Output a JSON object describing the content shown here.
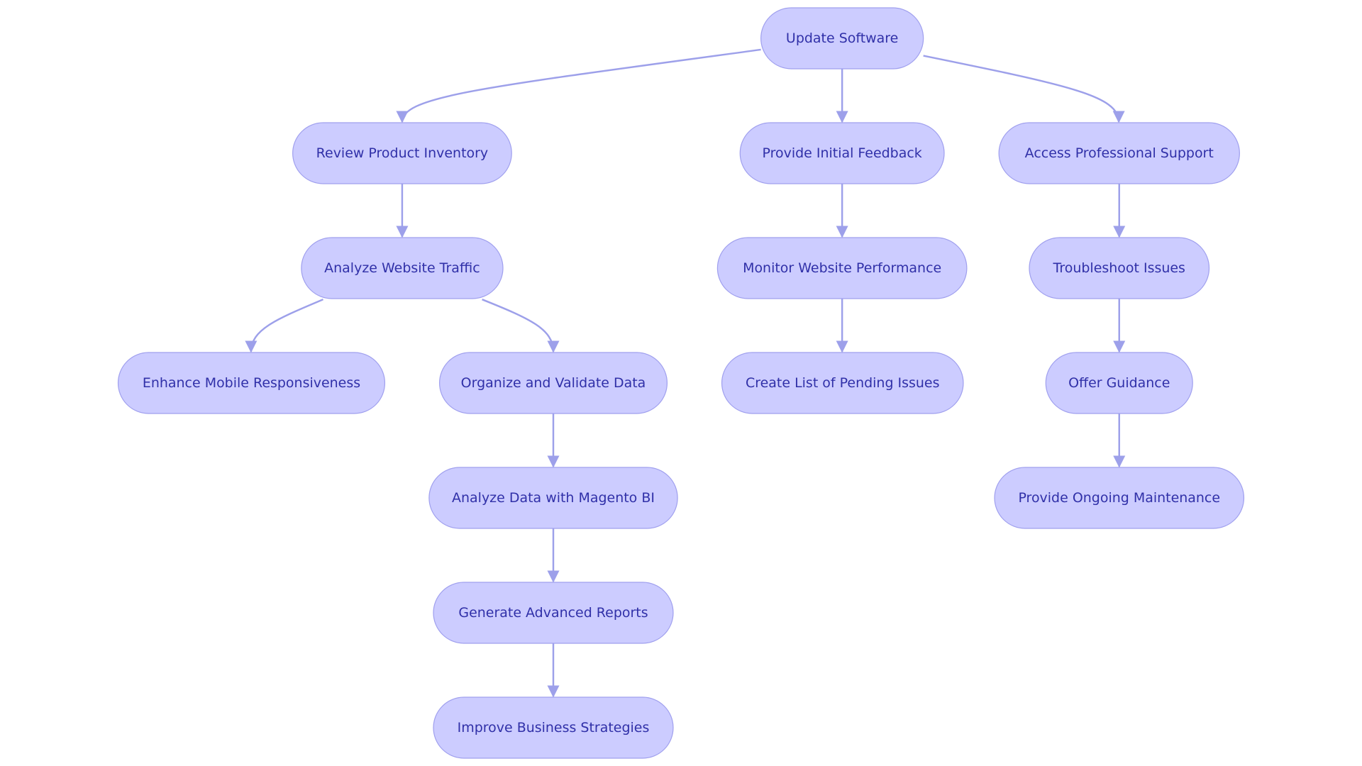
{
  "nodes": [
    {
      "id": "update",
      "label": "Update Software"
    },
    {
      "id": "review",
      "label": "Review Product Inventory"
    },
    {
      "id": "feedback",
      "label": "Provide Initial Feedback"
    },
    {
      "id": "support",
      "label": "Access Professional Support"
    },
    {
      "id": "traffic",
      "label": "Analyze Website Traffic"
    },
    {
      "id": "monitor",
      "label": "Monitor Website Performance"
    },
    {
      "id": "troubleshoot",
      "label": "Troubleshoot Issues"
    },
    {
      "id": "mobile",
      "label": "Enhance Mobile Responsiveness"
    },
    {
      "id": "organize",
      "label": "Organize and Validate Data"
    },
    {
      "id": "pending",
      "label": "Create List of Pending Issues"
    },
    {
      "id": "guidance",
      "label": "Offer Guidance"
    },
    {
      "id": "magento",
      "label": "Analyze Data with Magento BI"
    },
    {
      "id": "maintenance",
      "label": "Provide Ongoing Maintenance"
    },
    {
      "id": "reports",
      "label": "Generate Advanced Reports"
    },
    {
      "id": "strategies",
      "label": "Improve Business Strategies"
    }
  ],
  "edges": [
    [
      "update",
      "review"
    ],
    [
      "update",
      "feedback"
    ],
    [
      "update",
      "support"
    ],
    [
      "review",
      "traffic"
    ],
    [
      "traffic",
      "mobile"
    ],
    [
      "traffic",
      "organize"
    ],
    [
      "organize",
      "magento"
    ],
    [
      "magento",
      "reports"
    ],
    [
      "reports",
      "strategies"
    ],
    [
      "feedback",
      "monitor"
    ],
    [
      "monitor",
      "pending"
    ],
    [
      "support",
      "troubleshoot"
    ],
    [
      "troubleshoot",
      "guidance"
    ],
    [
      "guidance",
      "maintenance"
    ]
  ],
  "colors": {
    "node_fill": "#ccccff",
    "node_stroke": "#a0a0ee",
    "text": "#3030a8",
    "edge": "#9da0ea"
  }
}
